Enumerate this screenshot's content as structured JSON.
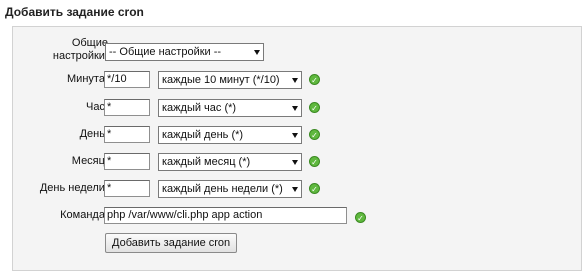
{
  "form": {
    "title": "Добавить задание cron",
    "submit_label": "Добавить задание cron"
  },
  "common": {
    "label": "Общие\nнастройки:",
    "label_line1": "Общие",
    "label_line2": "настройки:",
    "select_value": "-- Общие настройки --"
  },
  "fields": [
    {
      "label": "Минута:",
      "value": "*/10",
      "select_value": "каждые 10 минут (*/10)"
    },
    {
      "label": "Час:",
      "value": "*",
      "select_value": "каждый час (*)"
    },
    {
      "label": "День:",
      "value": "*",
      "select_value": "каждый день (*)"
    },
    {
      "label": "Месяц:",
      "value": "*",
      "select_value": "каждый месяц (*)"
    },
    {
      "label": "День недели:",
      "value": "*",
      "select_value": "каждый день недели (*)"
    }
  ],
  "command": {
    "label": "Команда:",
    "value": "php /var/www/cli.php app action"
  },
  "icons": {
    "valid": "check-circle-icon",
    "select_arrow": "chevron-down-icon"
  },
  "colors": {
    "panel_bg": "#f4f4f4",
    "valid_green": "#5fb83e"
  }
}
